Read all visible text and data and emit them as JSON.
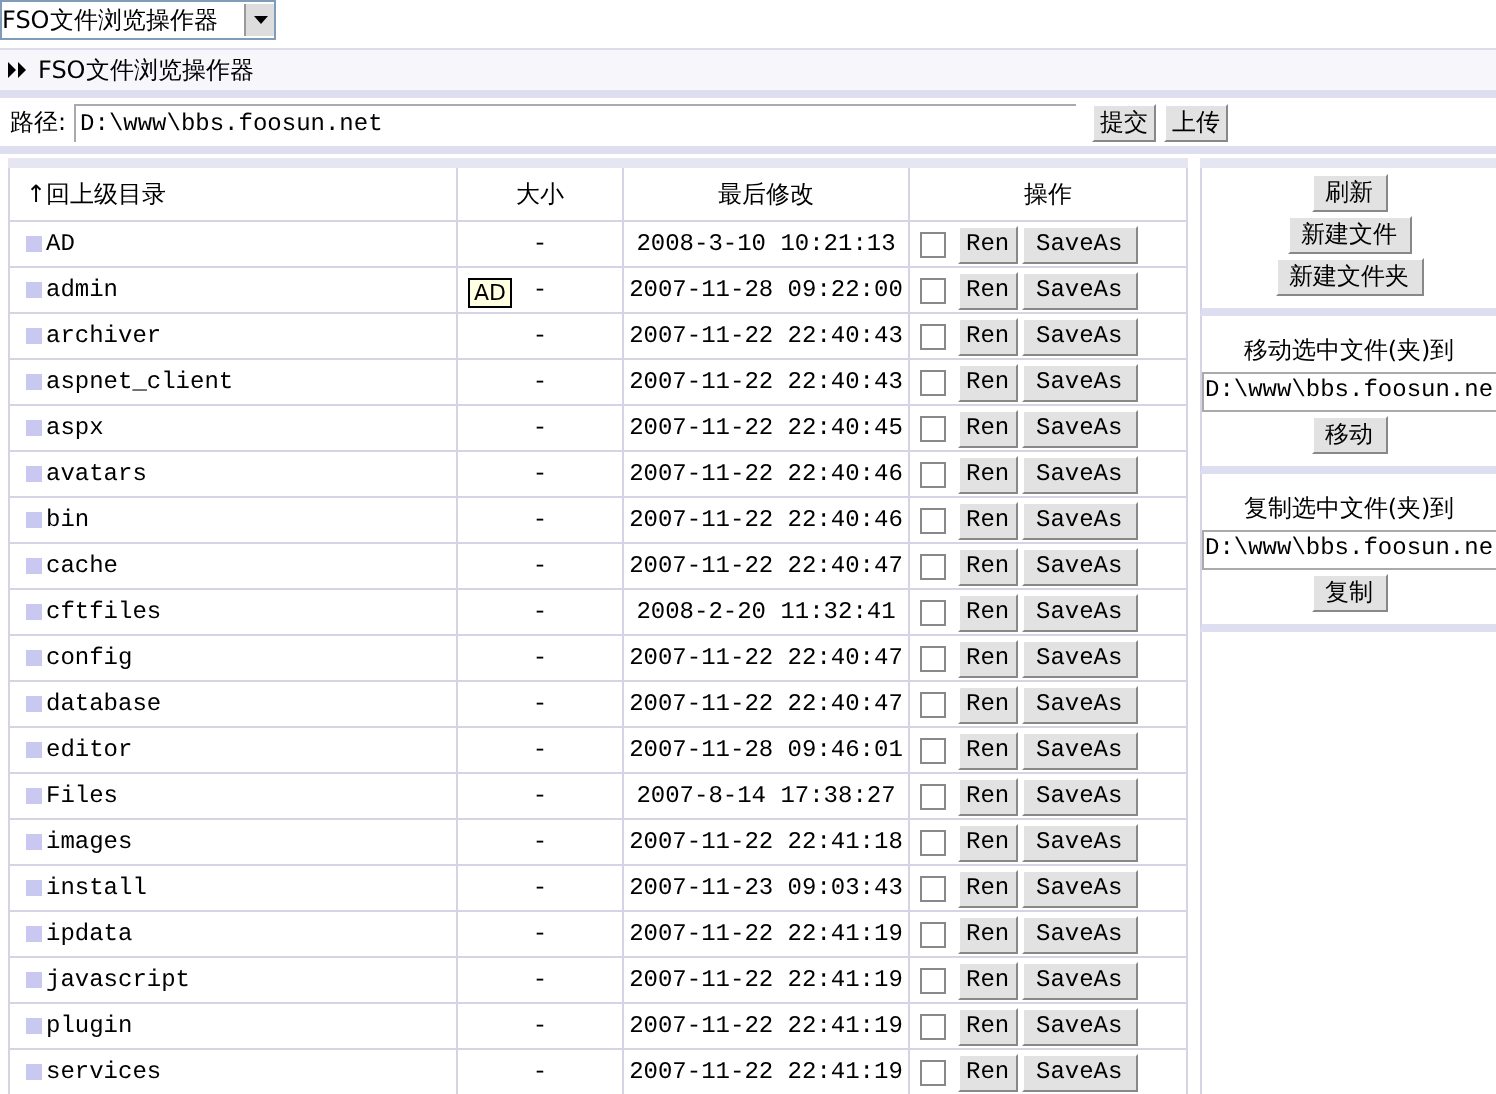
{
  "top_select": {
    "value": "FSO文件浏览操作器"
  },
  "title_bar": {
    "title": "FSO文件浏览操作器"
  },
  "path_bar": {
    "label": "路径:",
    "value": "D:\\www\\bbs.foosun.net",
    "buttons": [
      "提交",
      "上传"
    ]
  },
  "table": {
    "columns": [
      "↑回上级目录",
      "大小",
      "最后修改",
      "操作"
    ],
    "rows": [
      {
        "name": "AD",
        "size": "-",
        "modified": "2008-3-10 10:21:13",
        "checked": false,
        "actions": [
          "Ren",
          "SaveAs"
        ]
      },
      {
        "name": "admin",
        "size": "-",
        "modified": "2007-11-28 09:22:00",
        "checked": false,
        "actions": [
          "Ren",
          "SaveAs"
        ],
        "tooltip": "AD"
      },
      {
        "name": "archiver",
        "size": "-",
        "modified": "2007-11-22 22:40:43",
        "checked": false,
        "actions": [
          "Ren",
          "SaveAs"
        ]
      },
      {
        "name": "aspnet_client",
        "size": "-",
        "modified": "2007-11-22 22:40:43",
        "checked": false,
        "actions": [
          "Ren",
          "SaveAs"
        ]
      },
      {
        "name": "aspx",
        "size": "-",
        "modified": "2007-11-22 22:40:45",
        "checked": false,
        "actions": [
          "Ren",
          "SaveAs"
        ]
      },
      {
        "name": "avatars",
        "size": "-",
        "modified": "2007-11-22 22:40:46",
        "checked": false,
        "actions": [
          "Ren",
          "SaveAs"
        ]
      },
      {
        "name": "bin",
        "size": "-",
        "modified": "2007-11-22 22:40:46",
        "checked": false,
        "actions": [
          "Ren",
          "SaveAs"
        ]
      },
      {
        "name": "cache",
        "size": "-",
        "modified": "2007-11-22 22:40:47",
        "checked": false,
        "actions": [
          "Ren",
          "SaveAs"
        ]
      },
      {
        "name": "cftfiles",
        "size": "-",
        "modified": "2008-2-20 11:32:41",
        "checked": false,
        "actions": [
          "Ren",
          "SaveAs"
        ]
      },
      {
        "name": "config",
        "size": "-",
        "modified": "2007-11-22 22:40:47",
        "checked": false,
        "actions": [
          "Ren",
          "SaveAs"
        ]
      },
      {
        "name": "database",
        "size": "-",
        "modified": "2007-11-22 22:40:47",
        "checked": false,
        "actions": [
          "Ren",
          "SaveAs"
        ]
      },
      {
        "name": "editor",
        "size": "-",
        "modified": "2007-11-28 09:46:01",
        "checked": false,
        "actions": [
          "Ren",
          "SaveAs"
        ]
      },
      {
        "name": "Files",
        "size": "-",
        "modified": "2007-8-14 17:38:27",
        "checked": false,
        "actions": [
          "Ren",
          "SaveAs"
        ]
      },
      {
        "name": "images",
        "size": "-",
        "modified": "2007-11-22 22:41:18",
        "checked": false,
        "actions": [
          "Ren",
          "SaveAs"
        ]
      },
      {
        "name": "install",
        "size": "-",
        "modified": "2007-11-23 09:03:43",
        "checked": false,
        "actions": [
          "Ren",
          "SaveAs"
        ]
      },
      {
        "name": "ipdata",
        "size": "-",
        "modified": "2007-11-22 22:41:19",
        "checked": false,
        "actions": [
          "Ren",
          "SaveAs"
        ]
      },
      {
        "name": "javascript",
        "size": "-",
        "modified": "2007-11-22 22:41:19",
        "checked": false,
        "actions": [
          "Ren",
          "SaveAs"
        ]
      },
      {
        "name": "plugin",
        "size": "-",
        "modified": "2007-11-22 22:41:19",
        "checked": false,
        "actions": [
          "Ren",
          "SaveAs"
        ]
      },
      {
        "name": "services",
        "size": "-",
        "modified": "2007-11-22 22:41:19",
        "checked": false,
        "actions": [
          "Ren",
          "SaveAs"
        ]
      }
    ]
  },
  "side_panel": {
    "buttons": [
      "刷新",
      "新建文件",
      "新建文件夹"
    ],
    "move": {
      "label": "移动选中文件(夹)到",
      "value": "D:\\www\\bbs.foosun.ne",
      "button": "移动"
    },
    "copy": {
      "label": "复制选中文件(夹)到",
      "value": "D:\\www\\bbs.foosun.ne",
      "button": "复制"
    }
  }
}
